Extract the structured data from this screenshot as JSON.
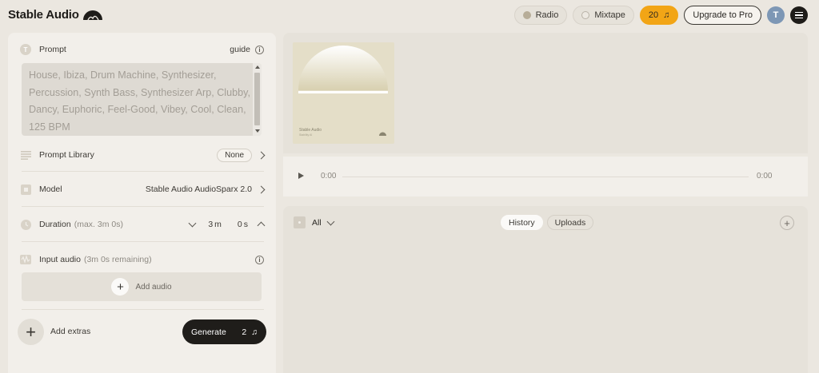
{
  "brand": {
    "name": "Stable Audio",
    "logo_icon": "half-sun-waves-icon"
  },
  "header": {
    "radio_label": "Radio",
    "mixtape_label": "Mixtape",
    "credits": "20",
    "upgrade_label": "Upgrade to Pro",
    "avatar_initial": "T",
    "accent_color": "#f2a516"
  },
  "prompt": {
    "label": "Prompt",
    "guide_label": "guide",
    "text": "House, Ibiza, Drum Machine, Synthesizer, Percussion, Synth Bass, Synthesizer Arp, Clubby, Dancy, Euphoric, Feel-Good, Vibey, Cool, Clean, 125 BPM"
  },
  "library": {
    "label": "Prompt Library",
    "value": "None"
  },
  "model": {
    "label": "Model",
    "value": "Stable Audio AudioSparx 2.0"
  },
  "duration": {
    "label": "Duration",
    "max": "(max. 3m 0s)",
    "minutes": "3",
    "minutes_unit": "m",
    "seconds": "0",
    "seconds_unit": "s"
  },
  "input_audio": {
    "label": "Input audio",
    "remaining": "(3m 0s remaining)",
    "add_label": "Add audio"
  },
  "extras": {
    "label": "Add extras"
  },
  "generate": {
    "label": "Generate",
    "cost": "2"
  },
  "cover": {
    "title": "Stable Audio",
    "subtitle": "Stability AI"
  },
  "player": {
    "current_time": "0:00",
    "total_time": "0:00",
    "progress": 0
  },
  "library_list": {
    "filter_label": "All",
    "tabs": [
      {
        "label": "History",
        "active": true
      },
      {
        "label": "Uploads",
        "active": false
      }
    ]
  }
}
